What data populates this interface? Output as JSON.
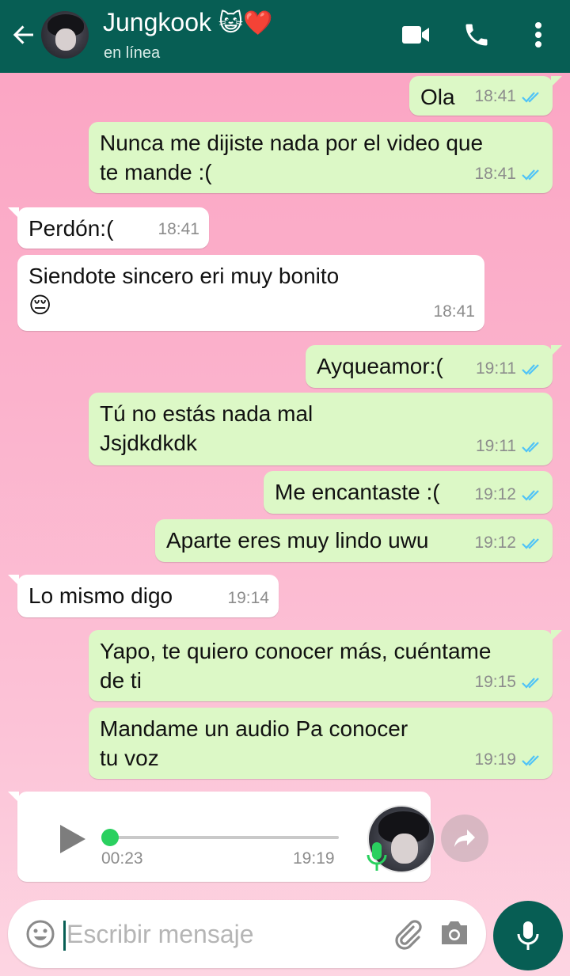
{
  "header": {
    "contact_name": "Jungkook",
    "name_emojis": "😺❤️",
    "status": "en línea",
    "icons": [
      "back-arrow-icon",
      "video-call-icon",
      "phone-icon",
      "more-vert-icon"
    ]
  },
  "messages": [
    {
      "dir": "out",
      "text": "Ola",
      "time": "18:41"
    },
    {
      "dir": "out",
      "text": "Nunca me dijiste nada por el video que\nte mande :(",
      "time": "18:41"
    },
    {
      "dir": "in",
      "text": "Perdón:(",
      "time": "18:41"
    },
    {
      "dir": "in",
      "text": "Siendote sincero eri muy bonito\n😔",
      "time": "18:41"
    },
    {
      "dir": "out",
      "text": "Ayqueamor:(",
      "time": "19:11"
    },
    {
      "dir": "out",
      "text": "Tú no estás nada mal\nJsjdkdkdk",
      "time": "19:11"
    },
    {
      "dir": "out",
      "text": "Me encantaste :(",
      "time": "19:12"
    },
    {
      "dir": "out",
      "text": "Aparte eres muy lindo uwu",
      "time": "19:12"
    },
    {
      "dir": "in",
      "text": "Lo mismo digo",
      "time": "19:14"
    },
    {
      "dir": "out",
      "text": "Yapo, te quiero conocer más, cuéntame\nde ti",
      "time": "19:15"
    },
    {
      "dir": "out",
      "text": "Mandame un audio Pa conocer\ntu voz",
      "time": "19:19"
    }
  ],
  "voice_note": {
    "duration": "00:23",
    "time": "19:19",
    "progress": 0.0
  },
  "input": {
    "placeholder": "Escribir mensaje"
  },
  "colors": {
    "header": "#075e54",
    "outgoing_bubble": "#dcf8c6",
    "incoming_bubble": "#ffffff",
    "read_ticks": "#4fc3f7"
  }
}
